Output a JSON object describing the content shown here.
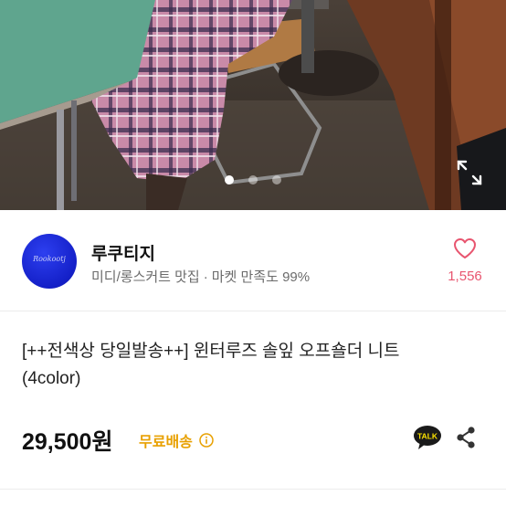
{
  "gallery": {
    "current_index": 1,
    "total_images": 3,
    "expand_icon": "expand-icon"
  },
  "seller": {
    "name": "루쿠티지",
    "avatar_logo_text": "Rookootj",
    "category": "미디/롱스커트 맛집",
    "separator": "·",
    "satisfaction": "마켓 만족도 99%",
    "like_icon": "heart-outline-icon",
    "like_count": "1,556"
  },
  "product": {
    "title_line1": "[++전색상 당일발송++] 윈터루즈 솔잎 오프숄더 니트",
    "title_line2": "(4color)",
    "price": "29,500원",
    "shipping": "무료배송",
    "shipping_info_icon": "info-circle-icon",
    "talk_icon_label": "TALK",
    "share_icon": "share-icon"
  },
  "colors": {
    "accent_pink": "#e8556f",
    "shipping_orange": "#e8a000",
    "avatar_blue": "#1f2fe0",
    "talk_yellow": "#fae100"
  }
}
